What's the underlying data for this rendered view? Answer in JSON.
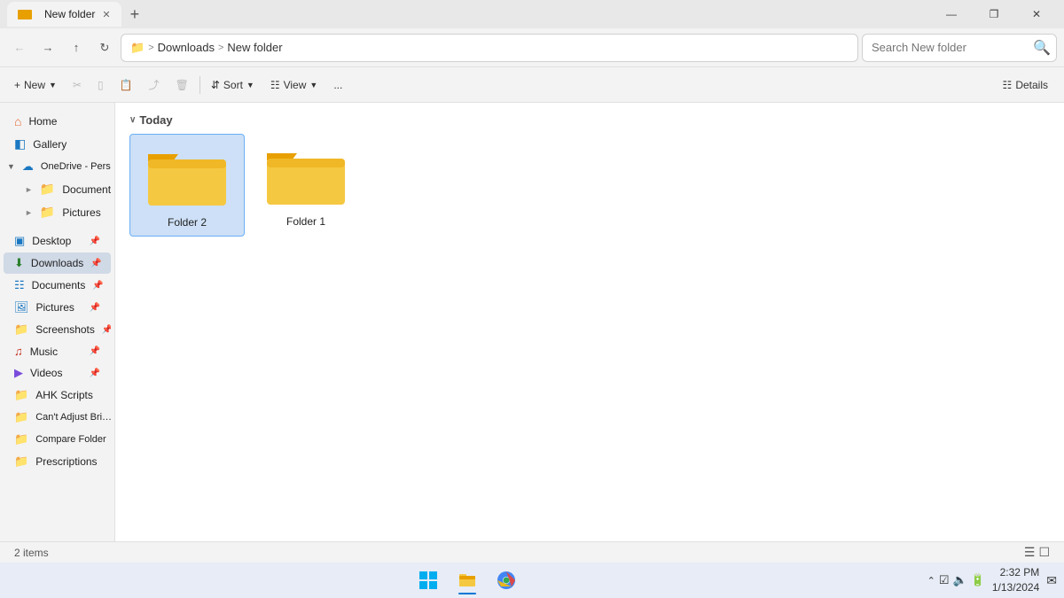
{
  "titlebar": {
    "tab_label": "New folder",
    "new_tab": "+",
    "minimize": "—",
    "maximize": "❐",
    "close": "✕"
  },
  "addressbar": {
    "breadcrumb_root": "Downloads",
    "breadcrumb_current": "New folder",
    "search_placeholder": "Search New folder"
  },
  "toolbar": {
    "new_label": "New",
    "sort_label": "Sort",
    "view_label": "View",
    "details_label": "Details",
    "more_label": "..."
  },
  "section": {
    "label": "Today",
    "arrow": "∨"
  },
  "sidebar": {
    "items": [
      {
        "label": "Home",
        "icon": "home",
        "indent": 0
      },
      {
        "label": "Gallery",
        "icon": "gallery",
        "indent": 0
      },
      {
        "label": "OneDrive - Pers…",
        "icon": "cloud",
        "indent": 0,
        "expanded": true
      },
      {
        "label": "Documents",
        "icon": "folder",
        "indent": 1
      },
      {
        "label": "Pictures",
        "icon": "folder",
        "indent": 1
      },
      {
        "label": "Desktop",
        "icon": "desktop",
        "indent": 0,
        "pinned": true
      },
      {
        "label": "Downloads",
        "icon": "download",
        "indent": 0,
        "pinned": true,
        "active": true
      },
      {
        "label": "Documents",
        "icon": "doc",
        "indent": 0,
        "pinned": true
      },
      {
        "label": "Pictures",
        "icon": "pictures",
        "indent": 0,
        "pinned": true
      },
      {
        "label": "Screenshots",
        "icon": "folder",
        "indent": 0,
        "pinned": true
      },
      {
        "label": "Music",
        "icon": "music",
        "indent": 0,
        "pinned": true
      },
      {
        "label": "Videos",
        "icon": "videos",
        "indent": 0,
        "pinned": true
      },
      {
        "label": "AHK Scripts",
        "icon": "folder-orange",
        "indent": 0
      },
      {
        "label": "Can't Adjust Bri…",
        "icon": "folder-orange",
        "indent": 0
      },
      {
        "label": "Compare Folder",
        "icon": "folder-orange",
        "indent": 0
      },
      {
        "label": "Prescriptions",
        "icon": "folder-orange",
        "indent": 0
      }
    ]
  },
  "folders": [
    {
      "label": "Folder 2",
      "selected": true
    },
    {
      "label": "Folder 1",
      "selected": false
    }
  ],
  "statusbar": {
    "count": "2 items",
    "layout_icons": "≡ ▭"
  },
  "taskbar": {
    "start_label": "⊞",
    "time": "2:32 PM",
    "date": "1/13/2024"
  }
}
